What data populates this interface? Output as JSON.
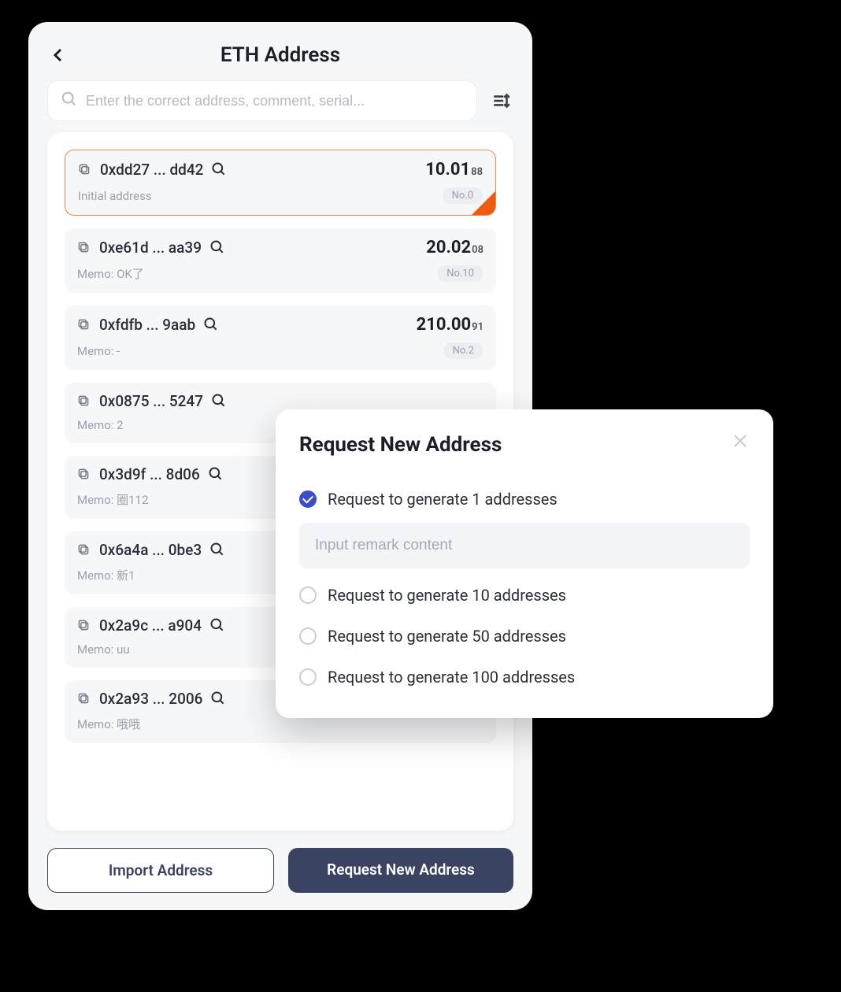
{
  "header": {
    "title": "ETH Address"
  },
  "search": {
    "placeholder": "Enter the correct address, comment, serial..."
  },
  "addresses": [
    {
      "addr": "0xdd27 ... dd42",
      "balance": "10.01",
      "decimals": "88",
      "memo": "Initial address",
      "num": "No.0",
      "selected": true,
      "showBalance": true
    },
    {
      "addr": "0xe61d ... aa39",
      "balance": "20.02",
      "decimals": "08",
      "memo": "Memo: OK了",
      "num": "No.10",
      "selected": false,
      "showBalance": true
    },
    {
      "addr": "0xfdfb ... 9aab",
      "balance": "210.00",
      "decimals": "91",
      "memo": "Memo: -",
      "num": "No.2",
      "selected": false,
      "showBalance": true
    },
    {
      "addr": "0x0875 ... 5247",
      "balance": "",
      "decimals": "",
      "memo": "Memo: 2",
      "num": "",
      "selected": false,
      "showBalance": false
    },
    {
      "addr": "0x3d9f ... 8d06",
      "balance": "",
      "decimals": "",
      "memo": "Memo: 圈112",
      "num": "",
      "selected": false,
      "showBalance": false
    },
    {
      "addr": "0x6a4a ... 0be3",
      "balance": "",
      "decimals": "",
      "memo": "Memo: 新1",
      "num": "",
      "selected": false,
      "showBalance": false
    },
    {
      "addr": "0x2a9c ... a904",
      "balance": "",
      "decimals": "",
      "memo": "Memo: uu",
      "num": "",
      "selected": false,
      "showBalance": false
    },
    {
      "addr": "0x2a93 ... 2006",
      "balance": "",
      "decimals": "",
      "memo": "Memo: 哦哦",
      "num": "",
      "selected": false,
      "showBalance": false
    }
  ],
  "buttons": {
    "import": "Import Address",
    "request": "Request New Address"
  },
  "modal": {
    "title": "Request New Address",
    "remark_placeholder": "Input remark content",
    "options": [
      {
        "label": "Request to generate 1 addresses",
        "checked": true,
        "showRemark": true
      },
      {
        "label": "Request to generate 10 addresses",
        "checked": false,
        "showRemark": false
      },
      {
        "label": "Request to generate 50 addresses",
        "checked": false,
        "showRemark": false
      },
      {
        "label": "Request to generate 100 addresses",
        "checked": false,
        "showRemark": false
      }
    ]
  }
}
